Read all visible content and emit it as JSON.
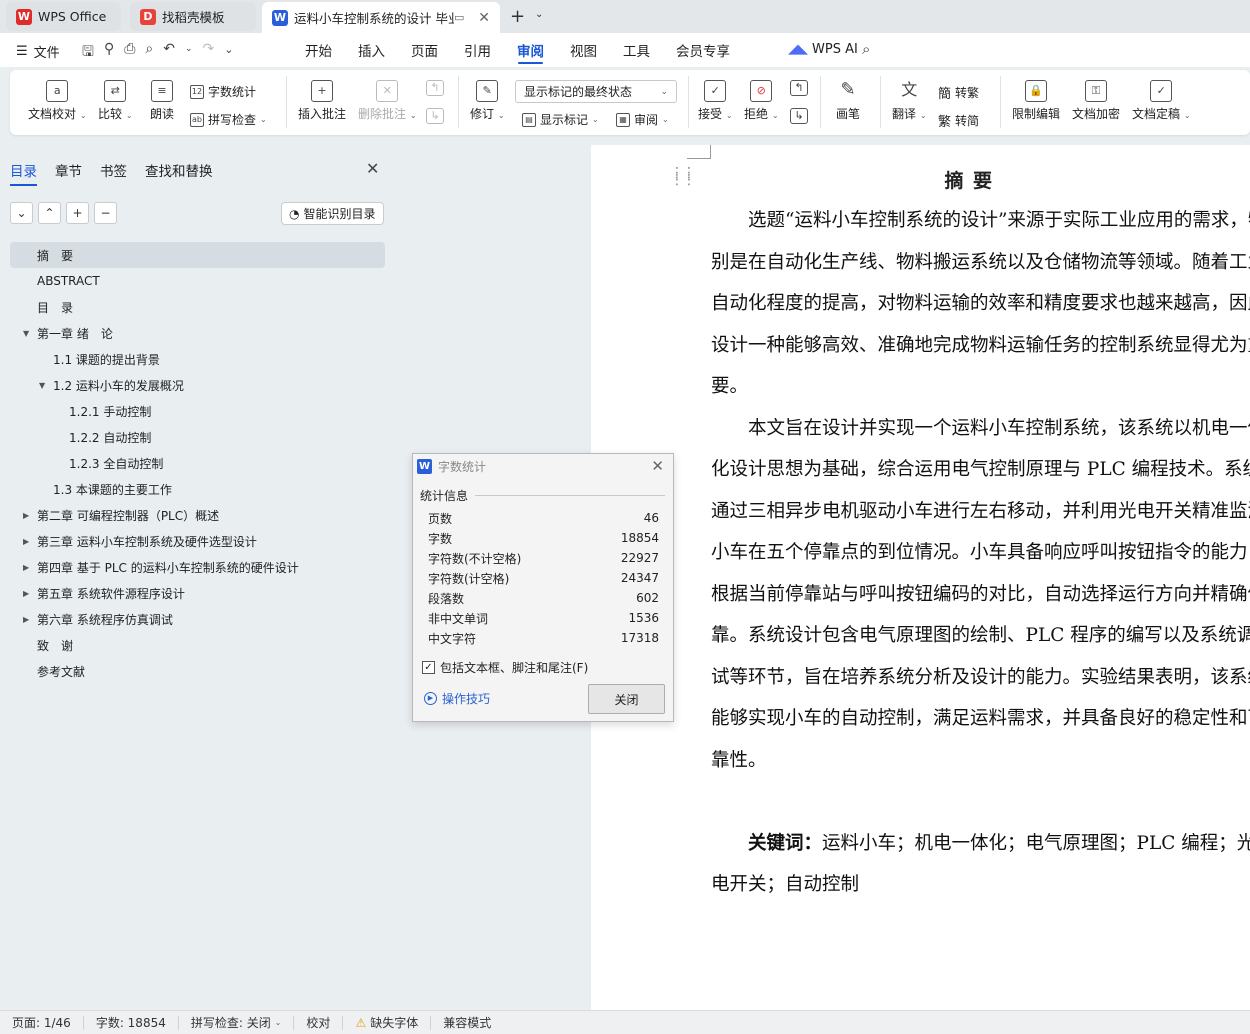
{
  "tabs": [
    {
      "label": "WPS Office",
      "icon": "wps-logo-icon"
    },
    {
      "label": "找稻壳模板",
      "icon": "docer-logo-icon"
    },
    {
      "label": "运料小车控制系统的设计 毕业",
      "icon": "writer-logo-icon"
    }
  ],
  "menubar": {
    "file_label": "文件",
    "items": [
      "开始",
      "插入",
      "页面",
      "引用",
      "审阅",
      "视图",
      "工具",
      "会员专享"
    ],
    "active": "审阅",
    "wps_ai": "WPS AI"
  },
  "ribbon": {
    "doc_check": "文档校对",
    "compare": "比较",
    "read_aloud": "朗读",
    "word_count": "字数统计",
    "spell_check": "拼写检查",
    "insert_comment": "插入批注",
    "delete_comment": "删除批注",
    "track_changes": "修订",
    "display_mode": "显示标记的最终状态",
    "show_markup": "显示标记",
    "review": "审阅",
    "accept": "接受",
    "reject": "拒绝",
    "pen": "画笔",
    "translate": "翻译",
    "to_traditional": "转繁",
    "to_simplified": "转简",
    "restrict_edit": "限制编辑",
    "encrypt": "文档加密",
    "finalize": "文档定稿"
  },
  "nav": {
    "tabs": [
      "目录",
      "章节",
      "书签",
      "查找和替换"
    ],
    "active_tab": "目录",
    "smart_button": "智能识别目录",
    "toc": [
      {
        "label": "摘　要",
        "level": 0,
        "expander": "",
        "selected": true
      },
      {
        "label": "ABSTRACT",
        "level": 0,
        "expander": ""
      },
      {
        "label": "目　录",
        "level": 0,
        "expander": ""
      },
      {
        "label": "第一章 绪　论",
        "level": 0,
        "expander": "expanded"
      },
      {
        "label": "1.1 课题的提出背景",
        "level": 1,
        "expander": ""
      },
      {
        "label": "1.2 运料小车的发展概况",
        "level": 1,
        "expander": "expanded"
      },
      {
        "label": "1.2.1 手动控制",
        "level": 2,
        "expander": ""
      },
      {
        "label": "1.2.2 自动控制",
        "level": 2,
        "expander": ""
      },
      {
        "label": "1.2.3 全自动控制",
        "level": 2,
        "expander": ""
      },
      {
        "label": "1.3 本课题的主要工作",
        "level": 1,
        "expander": ""
      },
      {
        "label": "第二章 可编程控制器（PLC）概述",
        "level": 0,
        "expander": "collapsed"
      },
      {
        "label": "第三章 运料小车控制系统及硬件选型设计",
        "level": 0,
        "expander": "collapsed"
      },
      {
        "label": "第四章 基于 PLC 的运料小车控制系统的硬件设计",
        "level": 0,
        "expander": "collapsed"
      },
      {
        "label": "第五章 系统软件源程序设计",
        "level": 0,
        "expander": "collapsed"
      },
      {
        "label": "第六章 系统程序仿真调试",
        "level": 0,
        "expander": "collapsed"
      },
      {
        "label": "致　谢",
        "level": 0,
        "expander": ""
      },
      {
        "label": "参考文献",
        "level": 0,
        "expander": ""
      }
    ]
  },
  "document": {
    "title": "摘要",
    "paragraphs": [
      "选题“运料小车控制系统的设计”来源于实际工业应用的需求，特别是在自动化生产线、物料搬运系统以及仓储物流等领域。随着工业自动化程度的提高，对物料运输的效率和精度要求也越来越高，因此设计一种能够高效、准确地完成物料运输任务的控制系统显得尤为重要。",
      "本文旨在设计并实现一个运料小车控制系统，该系统以机电一体化设计思想为基础，综合运用电气控制原理与 PLC 编程技术。系统通过三相异步电机驱动小车进行左右移动，并利用光电开关精准监测小车在五个停靠点的到位情况。小车具备响应呼叫按钮指令的能力，根据当前停靠站与呼叫按钮编码的对比，自动选择运行方向并精确停靠。系统设计包含电气原理图的绘制、PLC 程序的编写以及系统调试等环节，旨在培养系统分析及设计的能力。实验结果表明，该系统能够实现小车的自动控制，满足运料需求，并具备良好的稳定性和可靠性。"
    ],
    "keywords_label": "关键词：",
    "keywords": "运料小车；机电一体化；电气原理图；PLC 编程；光电开关；自动控制"
  },
  "dialog": {
    "title": "字数统计",
    "section": "统计信息",
    "stats": [
      {
        "label": "页数",
        "value": "46"
      },
      {
        "label": "字数",
        "value": "18854"
      },
      {
        "label": "字符数(不计空格)",
        "value": "22927"
      },
      {
        "label": "字符数(计空格)",
        "value": "24347"
      },
      {
        "label": "段落数",
        "value": "602"
      },
      {
        "label": "非中文单词",
        "value": "1536"
      },
      {
        "label": "中文字符",
        "value": "17318"
      }
    ],
    "checkbox_label": "包括文本框、脚注和尾注(F)",
    "checkbox_checked": true,
    "tips_label": "操作技巧",
    "close_label": "关闭"
  },
  "statusbar": {
    "page": "页面: 1/46",
    "words": "字数: 18854",
    "spell": "拼写检查: 关闭",
    "proof": "校对",
    "missing_font": "缺失字体",
    "compat": "兼容模式"
  }
}
